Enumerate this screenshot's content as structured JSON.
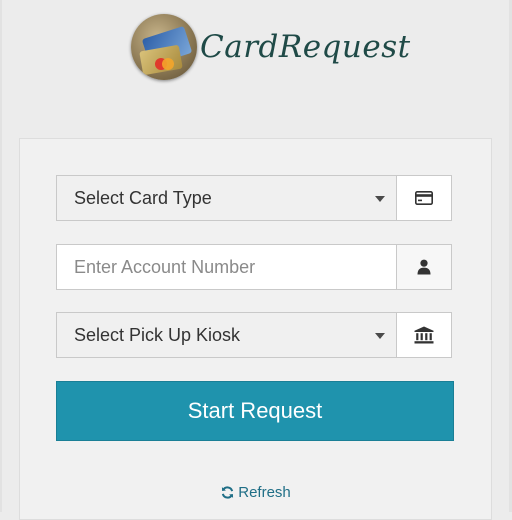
{
  "app": {
    "logo_text": "CardRequest"
  },
  "form": {
    "card_type": {
      "value": "Select Card Type",
      "icon": "credit-card-icon"
    },
    "account_number": {
      "placeholder": "Enter Account Number",
      "icon": "user-icon"
    },
    "pickup_kiosk": {
      "value": "Select Pick Up Kiosk",
      "icon": "bank-icon"
    },
    "start_button_label": "Start Request",
    "refresh_label": "Refresh"
  },
  "colors": {
    "primary_button": "#1f93ad",
    "refresh_link": "#1f6e86",
    "logo_text": "#1f4a47"
  }
}
